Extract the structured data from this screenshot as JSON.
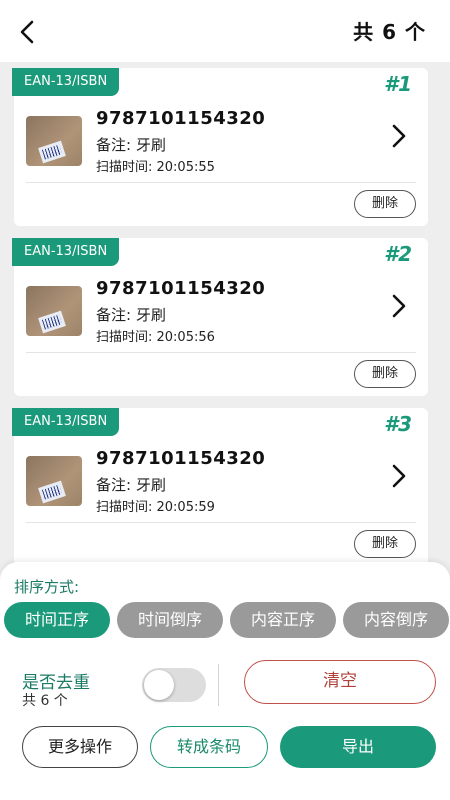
{
  "header": {
    "count_label": "共 6 个"
  },
  "items": [
    {
      "tag": "EAN-13/ISBN",
      "index": "#1",
      "code": "9787101154320",
      "note": "备注:  牙刷",
      "time": "扫描时间:  20:05:55",
      "delete_label": "删除"
    },
    {
      "tag": "EAN-13/ISBN",
      "index": "#2",
      "code": "9787101154320",
      "note": "备注:  牙刷",
      "time": "扫描时间:  20:05:56",
      "delete_label": "删除"
    },
    {
      "tag": "EAN-13/ISBN",
      "index": "#3",
      "code": "9787101154320",
      "note": "备注:  牙刷",
      "time": "扫描时间:  20:05:59",
      "delete_label": "删除"
    }
  ],
  "panel": {
    "sort_title": "排序方式:",
    "sort_options": [
      "时间正序",
      "时间倒序",
      "内容正序",
      "内容倒序"
    ],
    "sort_selected": "时间正序",
    "dedupe_title": "是否去重",
    "dedupe_count": "共 6 个",
    "dedupe_enabled": false,
    "clear_label": "清空",
    "more_label": "更多操作",
    "barcode_label": "转成条码",
    "export_label": "导出"
  },
  "colors": {
    "accent": "#1a9a7a",
    "sort_inactive": "#9a9a9a",
    "danger": "#c0504a"
  }
}
